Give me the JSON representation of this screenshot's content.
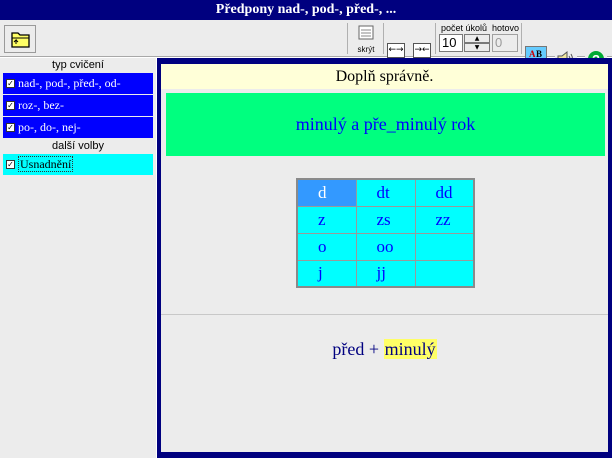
{
  "window": {
    "title": "Předpony nad-, pod-, před-, ..."
  },
  "toolbar": {
    "hide_label": "skrýt",
    "count_label": "počet úkolů",
    "count_value": "10",
    "done_label": "hotovo",
    "done_value": "0",
    "arrow_icons": [
      "←→",
      "→←",
      "↑↓",
      "↓↑"
    ],
    "abc_icon": "spell-check-icon",
    "sound_icon": "speaker-icon",
    "help_icon": "help-icon"
  },
  "sidebar": {
    "heading_exercise": "typ cvičení",
    "items": [
      {
        "label": "nad-, pod-, před-, od-",
        "checked": true
      },
      {
        "label": "roz-, bez-",
        "checked": true
      },
      {
        "label": "po-, do-, nej-",
        "checked": true
      }
    ],
    "heading_more": "další volby",
    "options": [
      {
        "label": "Usnadnění",
        "checked": true
      }
    ]
  },
  "main": {
    "instruction": "Doplň správně.",
    "task": "minulý a pře_minulý rok",
    "choices": [
      [
        "d",
        "dt",
        "dd"
      ],
      [
        "z",
        "zs",
        "zz"
      ],
      [
        "o",
        "oo",
        ""
      ],
      [
        "j",
        "jj",
        ""
      ]
    ],
    "hint_prefix": "před + ",
    "hint_highlight": "minulý"
  },
  "colors": {
    "title_bar": "#00007f",
    "sidebar_item": "#0000ff",
    "sidebar_option": "#00ffff",
    "task_band": "#00ff7f",
    "grid_cell": "#00ffff",
    "grid_selected": "#3399ff",
    "instruction_bg": "#ffffd8",
    "hint_highlight": "#ffff66"
  }
}
